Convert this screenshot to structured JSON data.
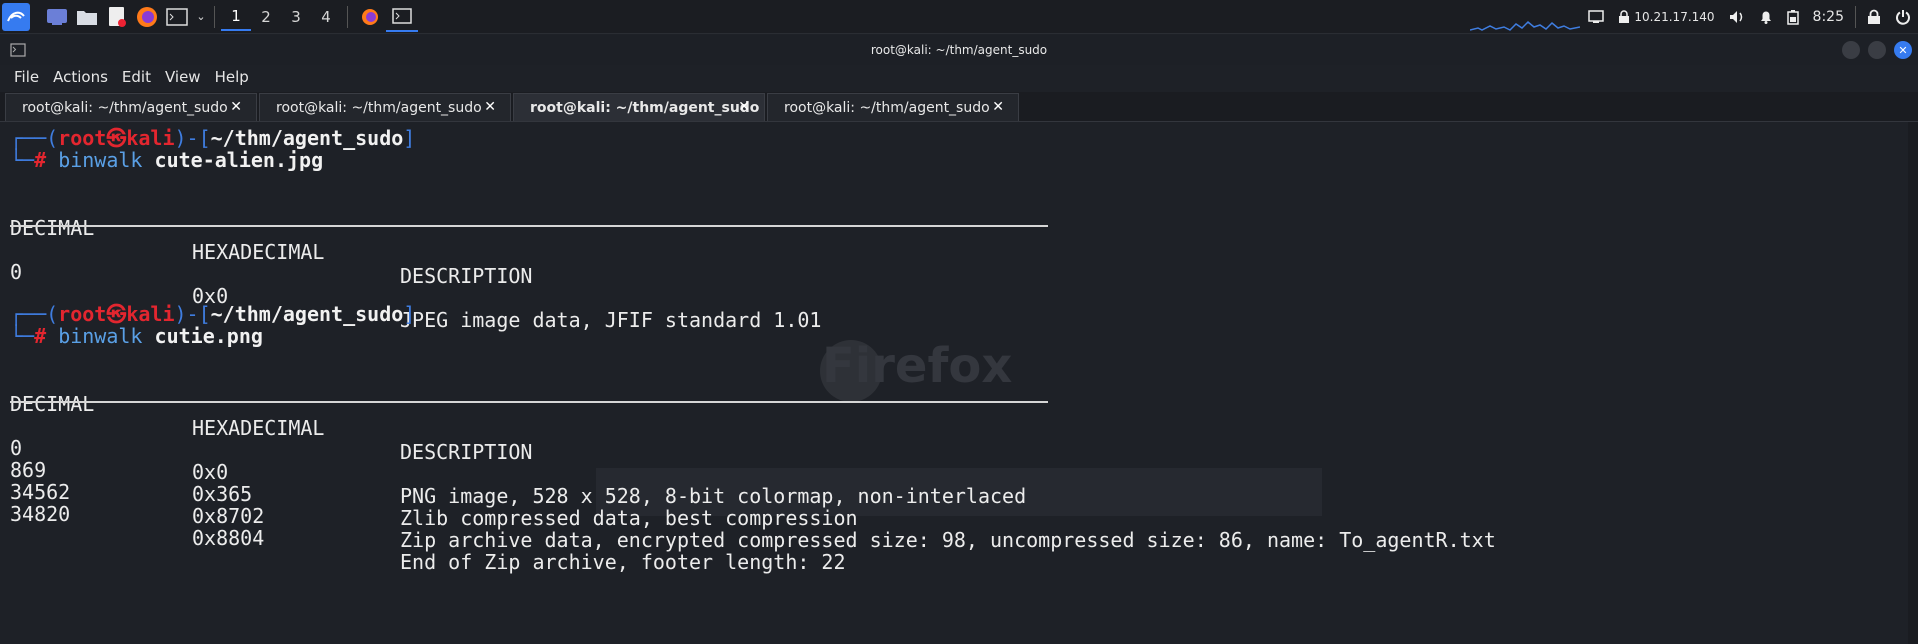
{
  "panel": {
    "workspaces": [
      "1",
      "2",
      "3",
      "4"
    ],
    "active_workspace": "1",
    "ip": "10.21.17.140",
    "time": "8:25"
  },
  "window": {
    "title": "root@kali: ~/thm/agent_sudo",
    "menu": [
      "File",
      "Actions",
      "Edit",
      "View",
      "Help"
    ],
    "tabs": [
      {
        "label": "root@kali: ~/thm/agent_sudo",
        "close": "✕"
      },
      {
        "label": "root@kali: ~/thm/agent_sudo",
        "close": "✕"
      },
      {
        "label": "root@kali: ~/thm/agent_sudo",
        "close": "✕"
      },
      {
        "label": "root@kali: ~/thm/agent_sudo",
        "close": "✕"
      }
    ]
  },
  "terminal": {
    "prompt_user": "root",
    "prompt_skull": "㉿",
    "prompt_host": "kali",
    "prompt_path": "~/thm/agent_sudo",
    "block1": {
      "cmd": "binwalk",
      "arg": "cute-alien.jpg",
      "headers": [
        "DECIMAL",
        "HEXADECIMAL",
        "DESCRIPTION"
      ],
      "rows": [
        [
          "0",
          "0x0",
          "JPEG image data, JFIF standard 1.01"
        ]
      ]
    },
    "block2": {
      "cmd": "binwalk",
      "arg": "cutie.png",
      "headers": [
        "DECIMAL",
        "HEXADECIMAL",
        "DESCRIPTION"
      ],
      "rows": [
        [
          "0",
          "0x0",
          "PNG image, 528 x 528, 8-bit colormap, non-interlaced"
        ],
        [
          "869",
          "0x365",
          "Zlib compressed data, best compression"
        ],
        [
          "34562",
          "0x8702",
          "Zip archive data, encrypted compressed size: 98, uncompressed size: 86, name: To_agentR.txt"
        ],
        [
          "34820",
          "0x8804",
          "End of Zip archive, footer length: 22"
        ]
      ]
    }
  },
  "background_ghost": {
    "firefox_label": "Firefox"
  },
  "colors": {
    "accent": "#367bf0",
    "prompt_red": "#e3262f",
    "prompt_blue": "#3f7de0",
    "bg": "#1e2127"
  }
}
